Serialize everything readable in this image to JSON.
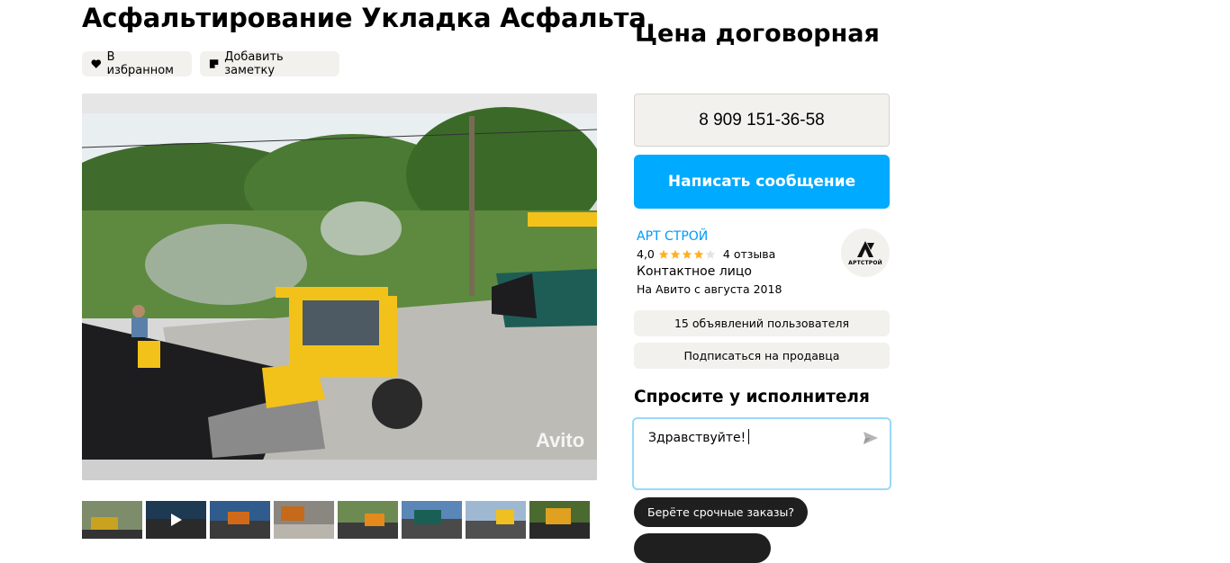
{
  "listing": {
    "title": "Асфальтирование Укладка Асфальта",
    "favorite_label": "В избранном",
    "note_label": "Добавить заметку",
    "photo_watermark": "Avito",
    "thumbnails": [
      {
        "icon": "thumb-photo"
      },
      {
        "icon": "play-icon"
      },
      {
        "icon": "thumb-photo"
      },
      {
        "icon": "thumb-photo"
      },
      {
        "icon": "thumb-photo"
      },
      {
        "icon": "thumb-photo"
      },
      {
        "icon": "thumb-photo"
      },
      {
        "icon": "thumb-photo"
      }
    ]
  },
  "sidebar": {
    "price": "Цена договорная",
    "phone": "8 909 151-36-58",
    "message_button": "Написать сообщение",
    "seller": {
      "name": "АРТ СТРОЙ",
      "rating": "4,0",
      "stars": 4,
      "stars_max": 5,
      "reviews": "4 отзыва",
      "contact_role": "Контактное лицо",
      "since": "На Авито с августа 2018",
      "avatar_label": "АРТСТРОЙ"
    },
    "listings_button": "15 объявлений пользователя",
    "subscribe_button": "Подписаться на продавца",
    "ask_title": "Спросите у исполнителя",
    "message_text": "Здравствуйте!",
    "quick_question": "Берёте срочные заказы?"
  },
  "colors": {
    "accent": "#00aaff",
    "seller_link": "#0099f7",
    "star": "#ffb021",
    "chip_bg": "#f2f1ed",
    "dark_pill": "#1f1f1f"
  }
}
